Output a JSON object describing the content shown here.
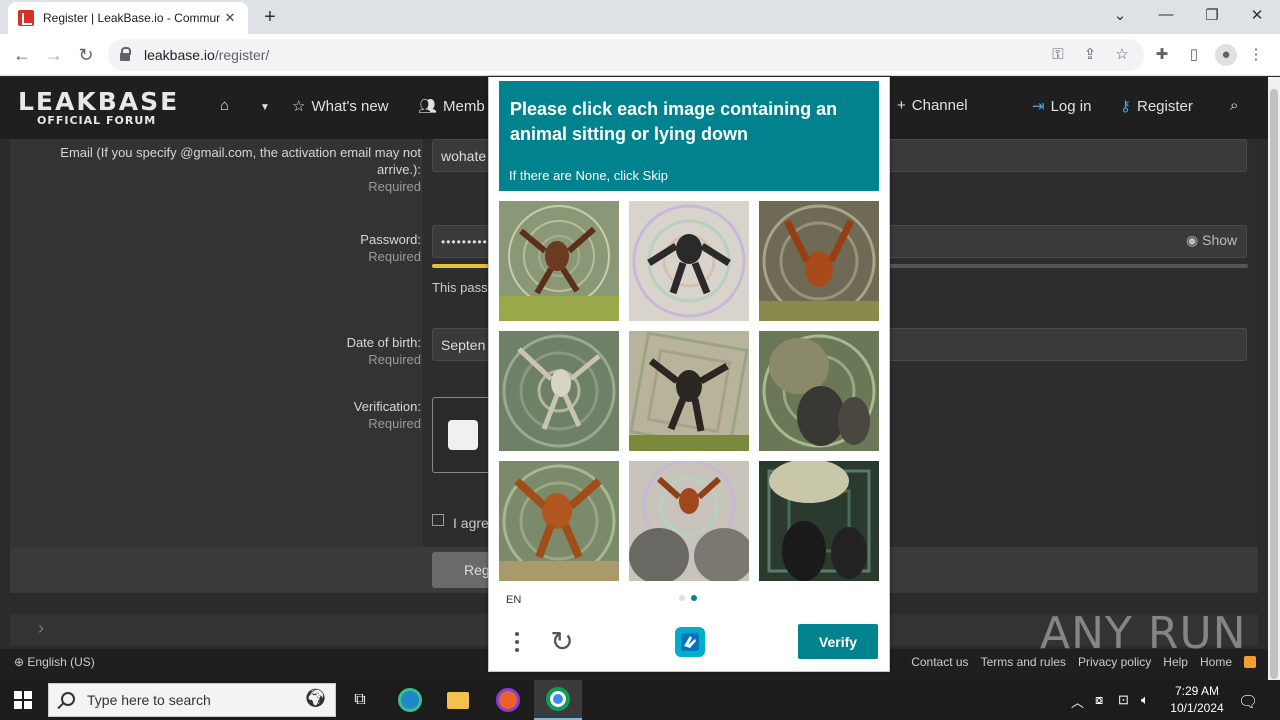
{
  "browser": {
    "tab_title": "Register | LeakBase.io - Commur",
    "url_host": "leakbase.io",
    "url_path": "/register/"
  },
  "site": {
    "logo_main": "LEAKBASE",
    "logo_sub": "OFFICIAL FORUM",
    "nav": {
      "whats_new": "What's new",
      "members": "Memb",
      "channel": "Channel",
      "login": "Log in",
      "register": "Register"
    }
  },
  "form": {
    "email_label": "Email (If you specify @gmail.com, the activation email may not arrive.):",
    "email_value": "wohate",
    "password_label": "Password:",
    "password_value": "••••••••••",
    "password_hint": "This pass",
    "show_label": "Show",
    "dob_label": "Date of birth:",
    "dob_value": "Septen",
    "verification_label": "Verification:",
    "required": "Required",
    "agree_text": "I agre",
    "register_button": "Reg"
  },
  "footer": {
    "language": "English (US)",
    "links": [
      "Contact us",
      "Terms and rules",
      "Privacy policy",
      "Help",
      "Home"
    ]
  },
  "watermark": "ANY RUN",
  "captcha": {
    "prompt": "Please click each image containing an animal sitting or lying down",
    "hint": "If there are None, click Skip",
    "language": "EN",
    "verify_label": "Verify",
    "accent": "#00838f"
  },
  "taskbar": {
    "search_placeholder": "Type here to search",
    "time": "7:29 AM",
    "date": "10/1/2024"
  }
}
